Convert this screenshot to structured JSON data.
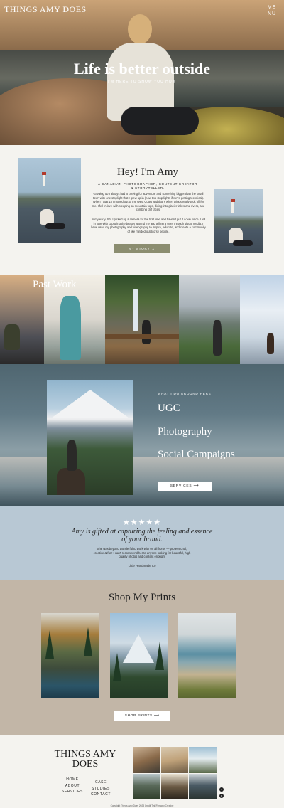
{
  "header": {
    "brand": "THINGS AMY DOES",
    "menu_line1": "ME",
    "menu_line2": "NU"
  },
  "hero": {
    "title": "Life is better outside",
    "subtitle": "I'M HERE TO SHOW YOU HOW"
  },
  "about": {
    "heading": "Hey! I'm Amy",
    "role": "A CANADIAN PHOTOGRAPHER, CONTENT CREATOR & STORYTELLER.",
    "paragraph1": "Growing up I always had a craving for adventure and something bigger than the small town with one stoplight that I grew up in (now two stop lights if we're getting technical). When I was 18 I moved out to the West Coast and that's when things really took off for me. I fell in love with sleeping on mountain tops, diving into glacier lakes and rivers, and climbing cliff faces.",
    "paragraph2": "In my early 20's I picked up a camera for the first time and haven't put it down since. I fell in love with capturing the beauty around me and telling a story through visual media. I have used my photography and videography to inspire, educate, and create a community of like minded outdoorsy people.",
    "button": "MY STORY →"
  },
  "past_work": {
    "title": "Past Work"
  },
  "services": {
    "kicker": "WHAT I DO AROUND HERE",
    "items": [
      "UGC",
      "Photography",
      "Social Campaigns"
    ],
    "button": "SERVICES ⟶"
  },
  "testimonial": {
    "stars": "★★★★★",
    "rating": 5,
    "quote": "Amy is gifted at capturing the feeling and essence of your brand.",
    "body": "She was beyond wonderful to work with on all fronts — professional, creative & fun! I can't recommend her to anyone looking for beautiful, high quality photos and content enough!",
    "source": "Little Handmade Co"
  },
  "prints": {
    "title": "Shop My Prints",
    "button": "SHOP PRINTS ⟶"
  },
  "footer": {
    "brand": "THINGS AMY DOES",
    "links_col1": [
      "HOME",
      "ABOUT",
      "SERVICES"
    ],
    "links_col2": [
      "CASE STUDIES",
      "CONTACT"
    ],
    "copyright": "Copyright Things Amy Does 2023 Credit TinEFirmway Creative",
    "social_icons": [
      "instagram-icon",
      "pinterest-icon"
    ]
  },
  "colors": {
    "story_button": "#8b8d70",
    "testimonial_bg": "#b8c8d4",
    "prints_bg": "#c2b6a7",
    "page_bg": "#f4f3ef"
  }
}
